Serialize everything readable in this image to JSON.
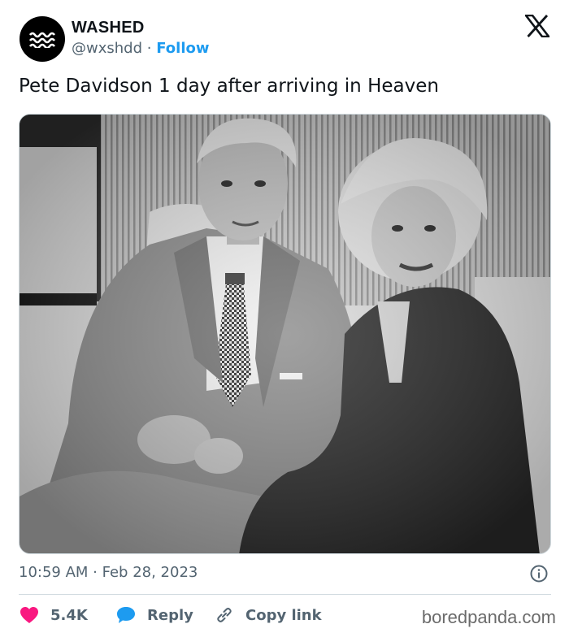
{
  "account": {
    "name": "WASHED",
    "handle": "@wxshdd",
    "separator": "·",
    "follow_label": "Follow",
    "avatar_icon": "waves-logo-icon"
  },
  "tweet": {
    "text": "Pete Davidson 1 day after arriving in Heaven",
    "image_icon": "black-and-white-photo-couple-on-sofa",
    "timestamp": "10:59 AM · Feb 28, 2023"
  },
  "actions": {
    "likes": "5.4K",
    "reply_label": "Reply",
    "copy_link_label": "Copy link"
  },
  "watermark": "boredpanda.com",
  "colors": {
    "like": "#f91880",
    "reply": "#1d9bf0",
    "follow": "#1d9bf0",
    "muted": "#536471",
    "text": "#0f1419"
  }
}
